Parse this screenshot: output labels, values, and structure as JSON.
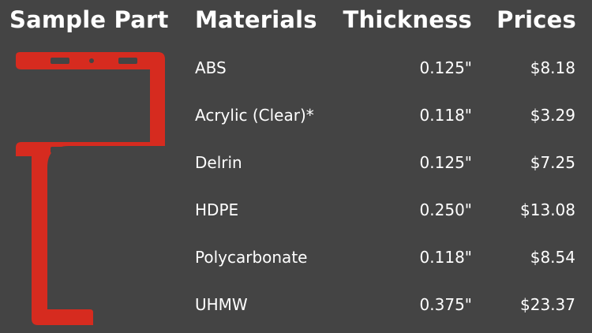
{
  "headers": {
    "part": "Sample Part",
    "materials": "Materials",
    "thickness": "Thickness",
    "prices": "Prices"
  },
  "rows": [
    {
      "material": "ABS",
      "thickness": "0.125\"",
      "price": "$8.18"
    },
    {
      "material": "Acrylic (Clear)*",
      "thickness": "0.118\"",
      "price": "$3.29"
    },
    {
      "material": "Delrin",
      "thickness": "0.125\"",
      "price": "$7.25"
    },
    {
      "material": "HDPE",
      "thickness": "0.250\"",
      "price": "$13.08"
    },
    {
      "material": "Polycarbonate",
      "thickness": "0.118\"",
      "price": "$8.54"
    },
    {
      "material": "UHMW",
      "thickness": "0.375\"",
      "price": "$23.37"
    }
  ],
  "colors": {
    "background": "#444444",
    "part": "#d62b1f",
    "text": "#ffffff"
  }
}
